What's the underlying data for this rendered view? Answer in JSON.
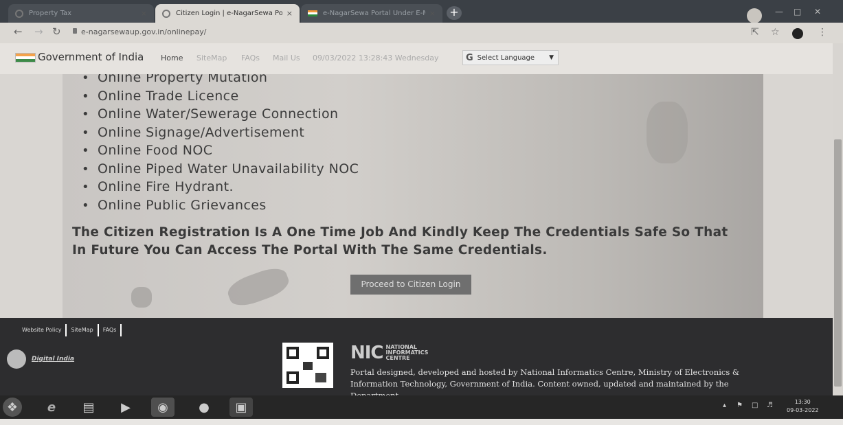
{
  "browser": {
    "tabs": [
      {
        "title": "Property Tax",
        "active": false
      },
      {
        "title": "Citizen Login | e-NagarSewa Po",
        "active": true
      },
      {
        "title": "e-NagarSewa Portal Under E-M",
        "active": false
      }
    ],
    "close_glyph": "×",
    "new_tab_glyph": "+",
    "url": "e-nagarsewaup.gov.in/onlinepay/"
  },
  "site_header": {
    "brand": "Government of India",
    "links": [
      "Home",
      "SiteMap",
      "FAQs",
      "Mail Us"
    ],
    "datetime": "09/03/2022 13:28:43 Wednesday",
    "language_select": "Select Language"
  },
  "hero": {
    "services": [
      "Online Property Mutation",
      "Online Trade Licence",
      "Online Water/Sewerage Connection",
      "Online Signage/Advertisement",
      "Online Food NOC",
      "Online Piped Water Unavailability NOC",
      "Online Fire Hydrant.",
      "Online Public Grievances"
    ],
    "notice": "The Citizen Registration Is A One Time Job And Kindly Keep The Credentials Safe So That In Future You Can Access The Portal With The Same Credentials.",
    "proceed_button": "Proceed to Citizen Login"
  },
  "footer": {
    "links": [
      "Website Policy",
      "SiteMap",
      "FAQs"
    ],
    "digital_india": "Digital India",
    "nic_logo": "NIC",
    "nic_full": [
      "NATIONAL",
      "INFORMATICS",
      "CENTRE"
    ],
    "note": "Portal designed, developed and hosted by National Informatics Centre, Ministry of Electronics & Information Technology, Government of India. Content owned, updated and maintained by the Department"
  },
  "taskbar": {
    "time": "13:30",
    "date": "09-03-2022"
  },
  "icons": [
    "back-arrow-icon",
    "forward-arrow-icon",
    "reload-icon",
    "lock-icon",
    "share-icon",
    "star-icon",
    "extension-icon",
    "menu-dots-icon",
    "google-icon",
    "qr-code-icon"
  ]
}
